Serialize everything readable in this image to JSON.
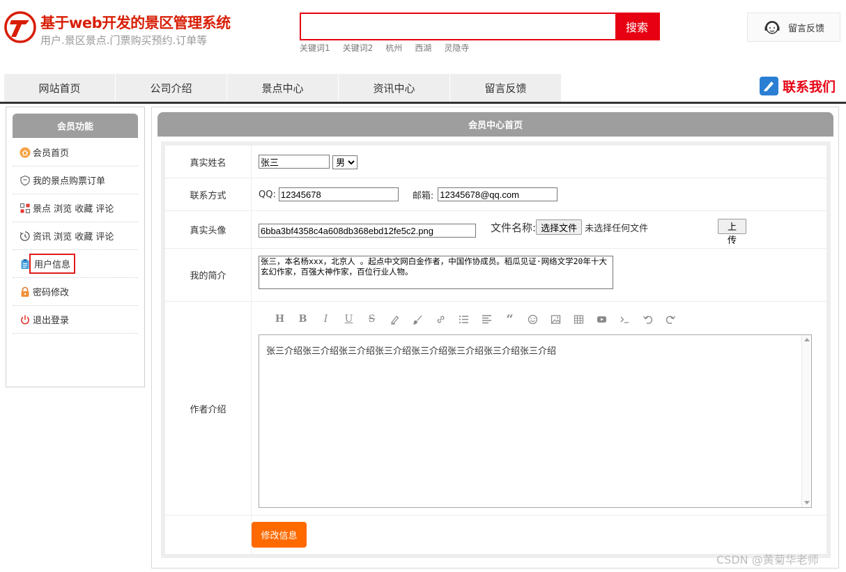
{
  "header": {
    "title": "基于web开发的景区管理系统",
    "subtitle": "用户.景区景点.门票购买预约.订单等",
    "search": {
      "placeholder": "",
      "button_label": "搜索"
    },
    "keywords": [
      "关键词1",
      "关键词2",
      "杭州",
      "西湖",
      "灵隐寺"
    ],
    "feedback_label": "留言反馈"
  },
  "nav": {
    "items": [
      "网站首页",
      "公司介绍",
      "景点中心",
      "资讯中心",
      "留言反馈"
    ],
    "contact_label": "联系我们"
  },
  "sidebar": {
    "title": "会员功能",
    "items": [
      {
        "label": "会员首页",
        "icon": "home-icon"
      },
      {
        "label": "我的景点购票订单",
        "icon": "shield-icon"
      },
      {
        "label": "景点 浏览 收藏 评论",
        "icon": "grid-icon"
      },
      {
        "label": "资讯 浏览 收藏 评论",
        "icon": "clock-icon"
      },
      {
        "label": "用户信息",
        "icon": "clipboard-icon",
        "active": true
      },
      {
        "label": "密码修改",
        "icon": "lock-icon"
      },
      {
        "label": "退出登录",
        "icon": "power-icon"
      }
    ]
  },
  "main": {
    "title": "会员中心首页",
    "form": {
      "name_label": "真实姓名",
      "name_value": "张三",
      "gender_value": "男",
      "contact_label": "联系方式",
      "qq_label": "QQ:",
      "qq_value": "12345678",
      "email_label": "邮箱:",
      "email_value": "12345678@qq.com",
      "avatar_label": "真实头像",
      "avatar_value": "6bba3bf4358c4a608db368ebd12fe5c2.png",
      "file_name_label": "文件名称:",
      "choose_file_label": "选择文件",
      "no_file_label": "未选择任何文件",
      "upload_label": "上 传",
      "bio_label": "我的简介",
      "bio_value": "张三，本名杨xxx，北京人 。起点中文网白金作者，中国作协成员。稻瓜见证·网络文学20年十大玄幻作家，百强大神作家，百位行业人物。",
      "author_label": "作者介绍",
      "author_value": "张三介绍张三介绍张三介绍张三介绍张三介绍张三介绍张三介绍张三介绍",
      "toolbar": [
        "heading-icon",
        "bold-icon",
        "italic-icon",
        "underline-icon",
        "strikethrough-icon",
        "highlighter-icon",
        "brush-icon",
        "link-icon",
        "list-icon",
        "align-icon",
        "quote-icon",
        "emoji-icon",
        "image-icon",
        "table-icon",
        "video-icon",
        "code-icon",
        "undo-icon",
        "redo-icon"
      ],
      "submit_label": "修改信息"
    }
  },
  "watermark": "CSDN @黄菊华老师",
  "colors": {
    "brand_red": "#d81e06",
    "accent_orange": "#ff6a00",
    "header_gray": "#9e9e9e"
  }
}
